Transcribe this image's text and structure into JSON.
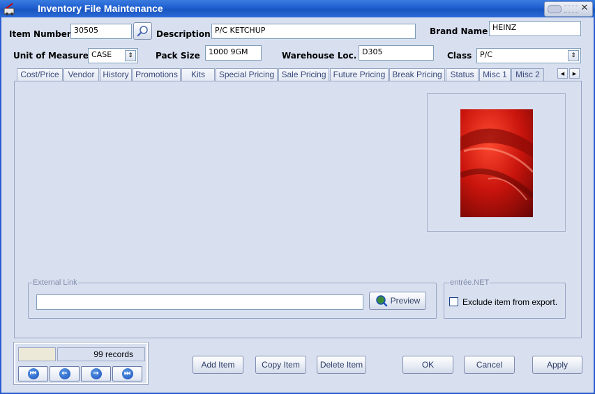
{
  "window": {
    "title": "Inventory File Maintenance"
  },
  "header": {
    "item_number_label": "Item Number",
    "item_number_value": "30505",
    "description_label": "Description",
    "description_value": "P/C KETCHUP",
    "brand_label": "Brand Name",
    "brand_value": "HEINZ",
    "uom_label": "Unit of Measure",
    "uom_value": "CASE",
    "pack_label": "Pack Size",
    "pack_value": "1000 9GM",
    "warehouse_label": "Warehouse Loc.",
    "warehouse_value": "D305",
    "class_label": "Class",
    "class_value": "P/C"
  },
  "tabs": [
    {
      "label": "Cost/Price"
    },
    {
      "label": "Vendor"
    },
    {
      "label": "History"
    },
    {
      "label": "Promotions"
    },
    {
      "label": "Kits"
    },
    {
      "label": "Special Pricing"
    },
    {
      "label": "Sale Pricing"
    },
    {
      "label": "Future Pricing"
    },
    {
      "label": "Break Pricing"
    },
    {
      "label": "Status"
    },
    {
      "label": "Misc 1"
    },
    {
      "label": "Misc 2"
    }
  ],
  "active_tab": "Misc 2",
  "external_link": {
    "group_title": "External Link",
    "value": "",
    "preview_label": "Preview"
  },
  "entree": {
    "group_title": "entrée.NET",
    "exclude_label": "Exclude item from export.",
    "exclude_checked": false
  },
  "navigator": {
    "records_text": "99 records"
  },
  "buttons": {
    "add_item": "Add Item",
    "copy_item": "Copy Item",
    "delete_item": "Delete Item",
    "ok": "OK",
    "cancel": "Cancel",
    "apply": "Apply"
  },
  "colors": {
    "title_bar": "#1f5fd0",
    "window_bg": "#d8e0f0",
    "image_red": "#c0140e"
  }
}
